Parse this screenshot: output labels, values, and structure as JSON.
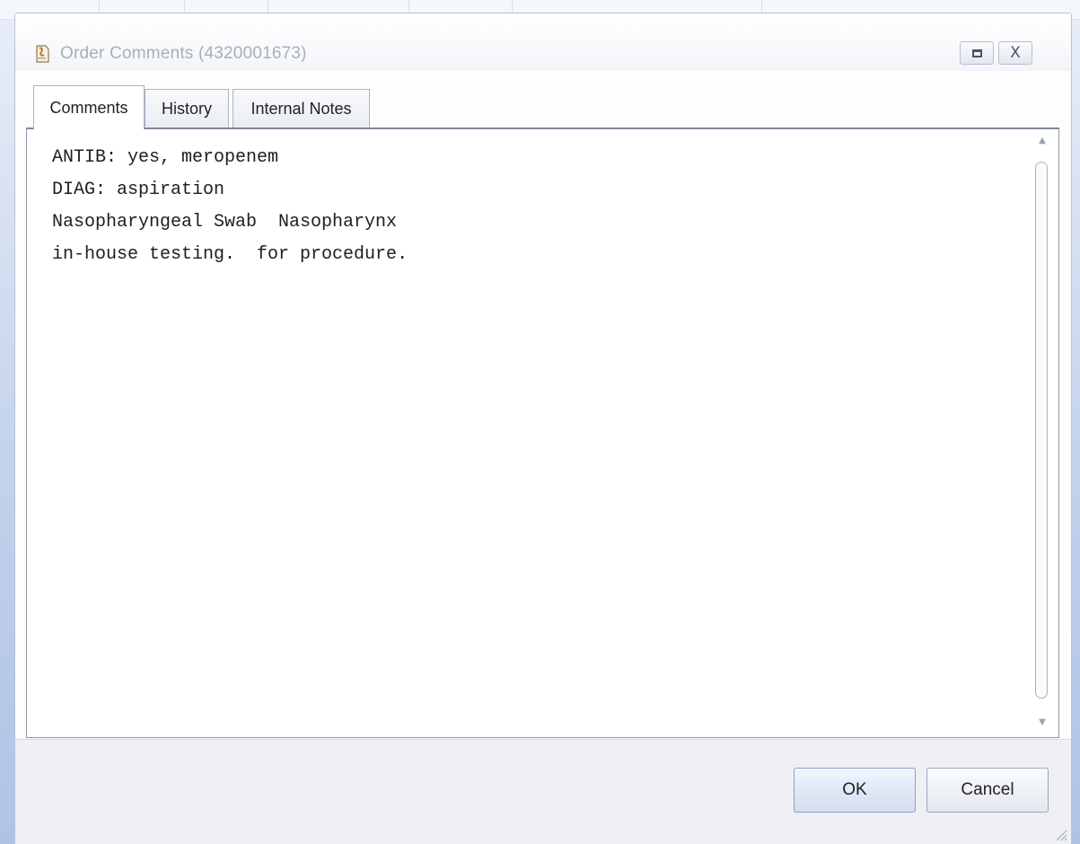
{
  "window": {
    "title": "Order Comments (4320001673)",
    "icon": "order-comments-icon",
    "maximize_icon": "maximize-icon",
    "close_label": "X"
  },
  "tabs": [
    {
      "label": "Comments",
      "active": true
    },
    {
      "label": "History",
      "active": false
    },
    {
      "label": "Internal Notes",
      "active": false
    }
  ],
  "comments": {
    "lines": [
      "ANTIB: yes, meropenem",
      "DIAG: aspiration",
      "Nasopharyngeal Swab  Nasopharynx",
      "in-house testing.  for procedure."
    ]
  },
  "buttons": {
    "ok": "OK",
    "cancel": "Cancel"
  },
  "colors": {
    "title_text": "#a8afba",
    "background": "#c3d2ec",
    "ok_button": "#d2ddf0"
  }
}
